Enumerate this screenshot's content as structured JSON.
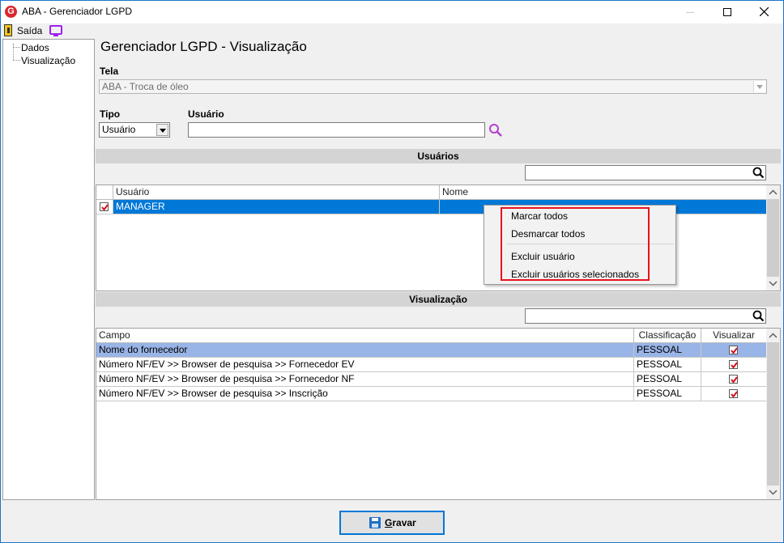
{
  "window": {
    "title": "ABA - Gerenciador LGPD"
  },
  "menu": {
    "exit_label": "Saída"
  },
  "tree": {
    "items": [
      "Dados",
      "Visualização"
    ]
  },
  "page": {
    "title": "Gerenciador LGPD - Visualização"
  },
  "tela": {
    "label": "Tela",
    "value": "ABA - Troca de óleo"
  },
  "tipo": {
    "label": "Tipo",
    "value": "Usuário"
  },
  "usuario_field": {
    "label": "Usuário",
    "value": ""
  },
  "usuarios_section": {
    "title": "Usuários",
    "columns": [
      "Usuário",
      "Nome"
    ],
    "rows": [
      {
        "checked": true,
        "usuario": "MANAGER",
        "nome": ""
      }
    ]
  },
  "context_menu": {
    "items": [
      "Marcar todos",
      "Desmarcar todos",
      "Excluir usuário",
      "Excluir usuários selecionados"
    ]
  },
  "visualizacao_section": {
    "title": "Visualização",
    "columns": [
      "Campo",
      "Classificação",
      "Visualizar"
    ],
    "rows": [
      {
        "campo": "Nome do fornecedor",
        "classificacao": "PESSOAL",
        "visualizar": true
      },
      {
        "campo": "Número NF/EV >> Browser de pesquisa >> Fornecedor EV",
        "classificacao": "PESSOAL",
        "visualizar": true
      },
      {
        "campo": "Número NF/EV >> Browser de pesquisa >> Fornecedor NF",
        "classificacao": "PESSOAL",
        "visualizar": true
      },
      {
        "campo": "Número NF/EV >> Browser de pesquisa >> Inscrição",
        "classificacao": "PESSOAL",
        "visualizar": true
      }
    ]
  },
  "save_button": {
    "first_letter": "G",
    "rest": "ravar"
  },
  "colors": {
    "selection": "#0078d7",
    "row_highlight": "#99b4e6",
    "annotation": "#e8121b",
    "check": "#d4121b"
  }
}
